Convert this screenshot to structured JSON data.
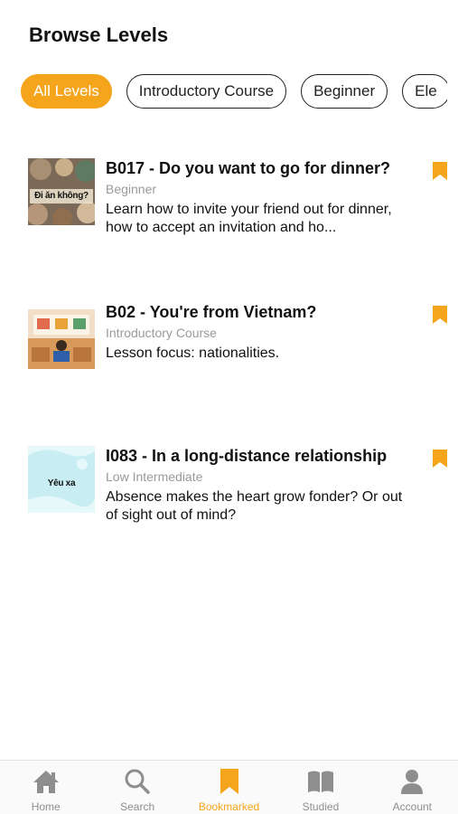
{
  "header": {
    "title": "Browse Levels"
  },
  "filters": [
    {
      "label": "All Levels",
      "active": true
    },
    {
      "label": "Introductory Course",
      "active": false
    },
    {
      "label": "Beginner",
      "active": false
    },
    {
      "label": "Ele",
      "active": false
    }
  ],
  "lessons": [
    {
      "title": "B017 - Do you want to go for dinner?",
      "level": "Beginner",
      "description": "Learn how to invite your friend out for dinner, how to accept an invitation and ho...",
      "thumb_text": "Đi ăn không?",
      "bookmarked": true
    },
    {
      "title": "B02 - You're from Vietnam?",
      "level": "Introductory Course",
      "description": "Lesson focus: nationalities.",
      "thumb_text": "",
      "bookmarked": true
    },
    {
      "title": "I083 - In a long-distance relationship",
      "level": "Low Intermediate",
      "description": "Absence makes the heart grow fonder? Or out of sight out of mind?",
      "thumb_text": "Yêu xa",
      "bookmarked": true
    }
  ],
  "tabbar": {
    "items": [
      {
        "label": "Home",
        "icon": "home-icon",
        "active": false
      },
      {
        "label": "Search",
        "icon": "search-icon",
        "active": false
      },
      {
        "label": "Bookmarked",
        "icon": "bookmark-icon",
        "active": true
      },
      {
        "label": "Studied",
        "icon": "book-icon",
        "active": false
      },
      {
        "label": "Account",
        "icon": "person-icon",
        "active": false
      }
    ]
  },
  "colors": {
    "accent": "#f5a51c",
    "inactive": "#8e8e8e",
    "muted_text": "#9a9a9a"
  }
}
